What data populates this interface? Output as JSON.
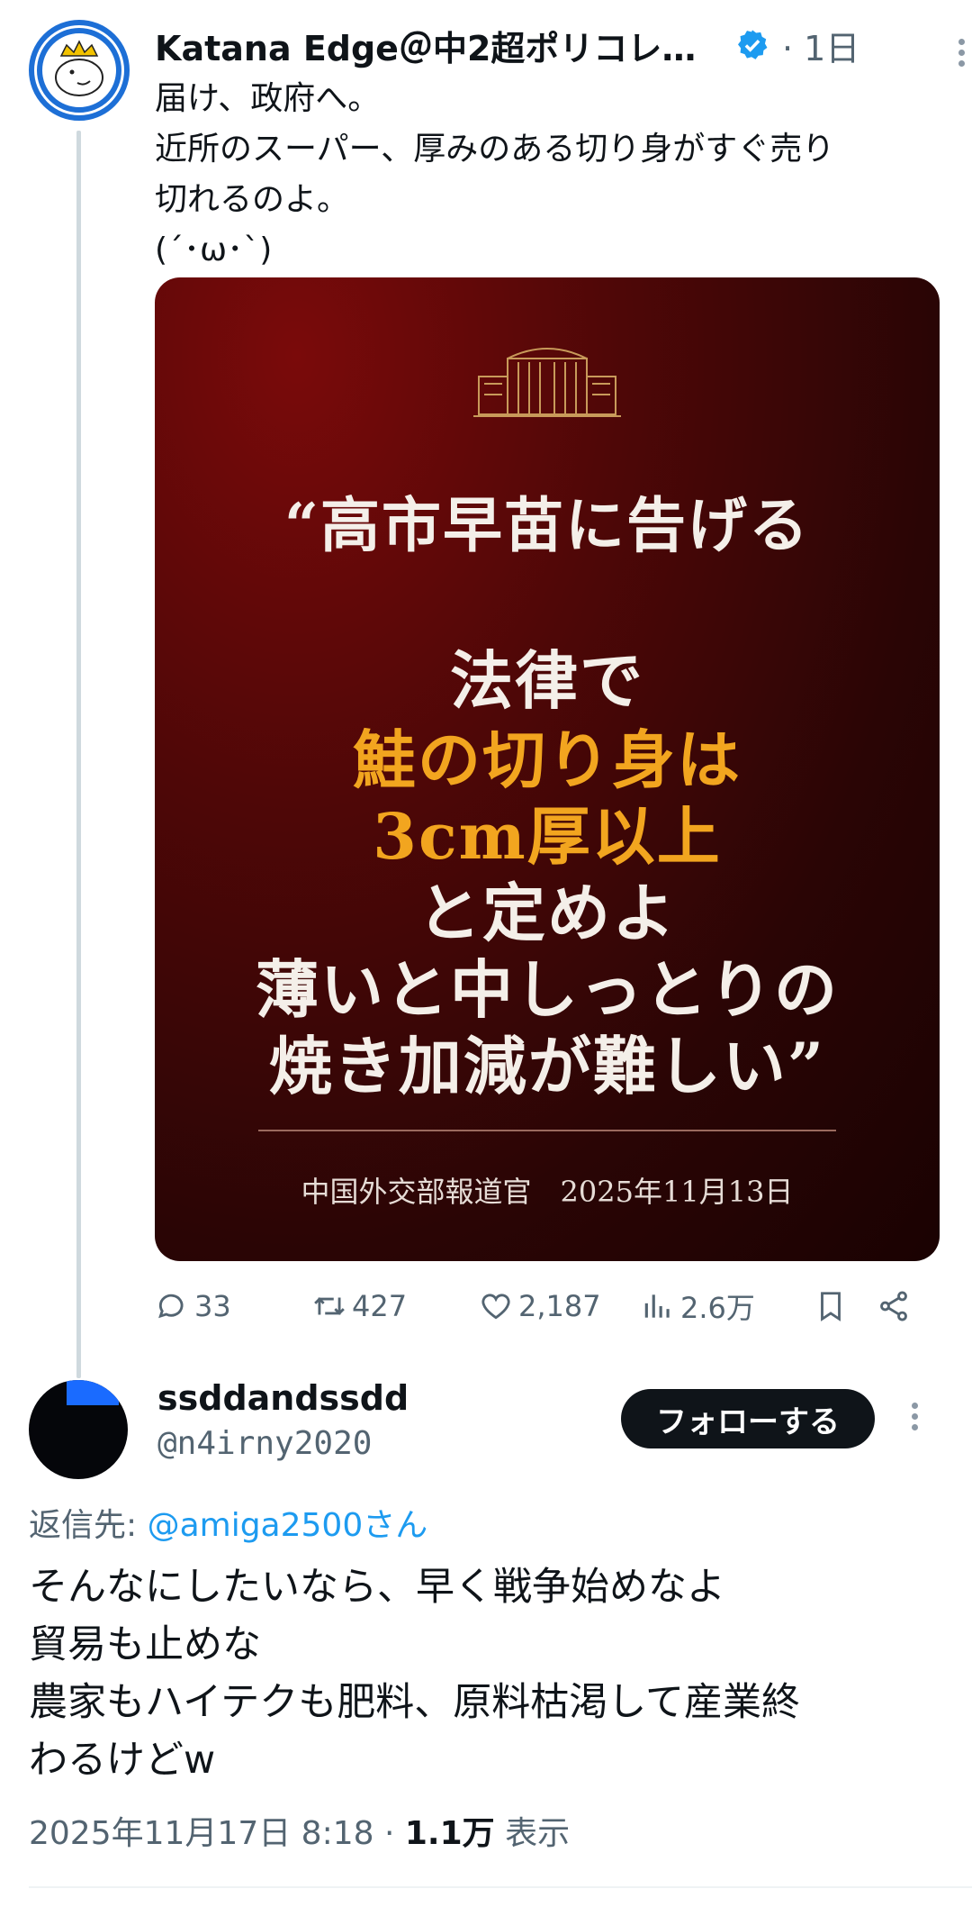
{
  "tweet": {
    "author_name": "Katana Edge＠中2超ポリコレリ...",
    "time": "· 1日",
    "text_lines": [
      "届け、政府へ。",
      "近所のスーパー、厚みのある切り身がすぐ売り",
      "切れるのよ。",
      "(´･ω･`)"
    ],
    "image": {
      "lines": [
        "“高市早苗に告げる",
        "法律で",
        "鮭の切り身は",
        "3cm厚以上",
        "と定めよ",
        "薄いと中しっとりの",
        "焼き加減が難しい”"
      ],
      "source": "中国外交部報道官　2025年11月13日",
      "highlight_color": "#f2a51f"
    },
    "actions": {
      "replies": "33",
      "retweets": "427",
      "likes": "2,187",
      "views": "2.6万"
    }
  },
  "reply": {
    "author_name": "ssddandssdd",
    "handle": "@n4irny2020",
    "follow_label": "フォローする",
    "reply_to_prefix": "返信先: ",
    "reply_to_mention": "@amiga2500さん",
    "text_lines": [
      "そんなにしたいなら、早く戦争始めなよ",
      "貿易も止めな",
      "農家もハイテクも肥料、原料枯渇して産業終",
      "わるけどw"
    ],
    "timestamp": "2025年11月17日 8:18 · ",
    "view_count": "1.1万",
    "view_label": " 表示"
  },
  "colors": {
    "accent": "#1d9bf0",
    "muted": "#536471",
    "verified": "#1d9bf0"
  }
}
